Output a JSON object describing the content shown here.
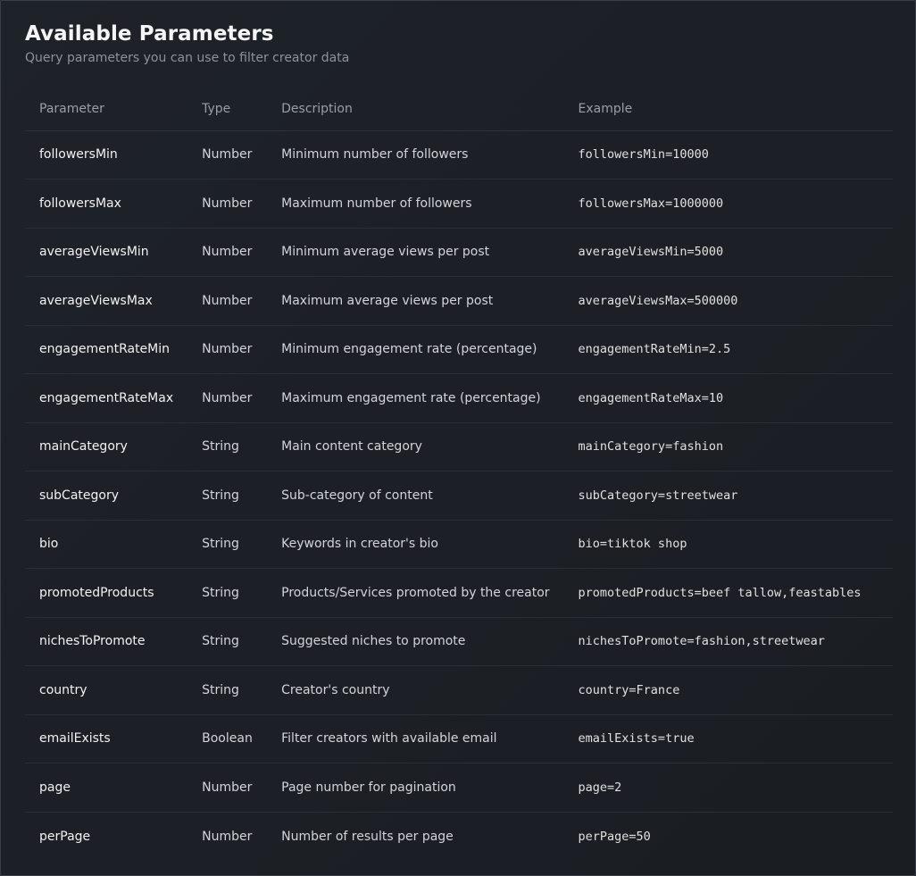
{
  "header": {
    "title": "Available Parameters",
    "subtitle": "Query parameters you can use to filter creator data"
  },
  "table": {
    "columns": [
      "Parameter",
      "Type",
      "Description",
      "Example"
    ],
    "rows": [
      {
        "parameter": "followersMin",
        "type": "Number",
        "description": "Minimum number of followers",
        "example": "followersMin=10000"
      },
      {
        "parameter": "followersMax",
        "type": "Number",
        "description": "Maximum number of followers",
        "example": "followersMax=1000000"
      },
      {
        "parameter": "averageViewsMin",
        "type": "Number",
        "description": "Minimum average views per post",
        "example": "averageViewsMin=5000"
      },
      {
        "parameter": "averageViewsMax",
        "type": "Number",
        "description": "Maximum average views per post",
        "example": "averageViewsMax=500000"
      },
      {
        "parameter": "engagementRateMin",
        "type": "Number",
        "description": "Minimum engagement rate (percentage)",
        "example": "engagementRateMin=2.5"
      },
      {
        "parameter": "engagementRateMax",
        "type": "Number",
        "description": "Maximum engagement rate (percentage)",
        "example": "engagementRateMax=10"
      },
      {
        "parameter": "mainCategory",
        "type": "String",
        "description": "Main content category",
        "example": "mainCategory=fashion"
      },
      {
        "parameter": "subCategory",
        "type": "String",
        "description": "Sub-category of content",
        "example": "subCategory=streetwear"
      },
      {
        "parameter": "bio",
        "type": "String",
        "description": "Keywords in creator's bio",
        "example": "bio=tiktok shop"
      },
      {
        "parameter": "promotedProducts",
        "type": "String",
        "description": "Products/Services promoted by the creator",
        "example": "promotedProducts=beef tallow,feastables"
      },
      {
        "parameter": "nichesToPromote",
        "type": "String",
        "description": "Suggested niches to promote",
        "example": "nichesToPromote=fashion,streetwear"
      },
      {
        "parameter": "country",
        "type": "String",
        "description": "Creator's country",
        "example": "country=France"
      },
      {
        "parameter": "emailExists",
        "type": "Boolean",
        "description": "Filter creators with available email",
        "example": "emailExists=true"
      },
      {
        "parameter": "page",
        "type": "Number",
        "description": "Page number for pagination",
        "example": "page=2"
      },
      {
        "parameter": "perPage",
        "type": "Number",
        "description": "Number of results per page",
        "example": "perPage=50"
      }
    ]
  }
}
